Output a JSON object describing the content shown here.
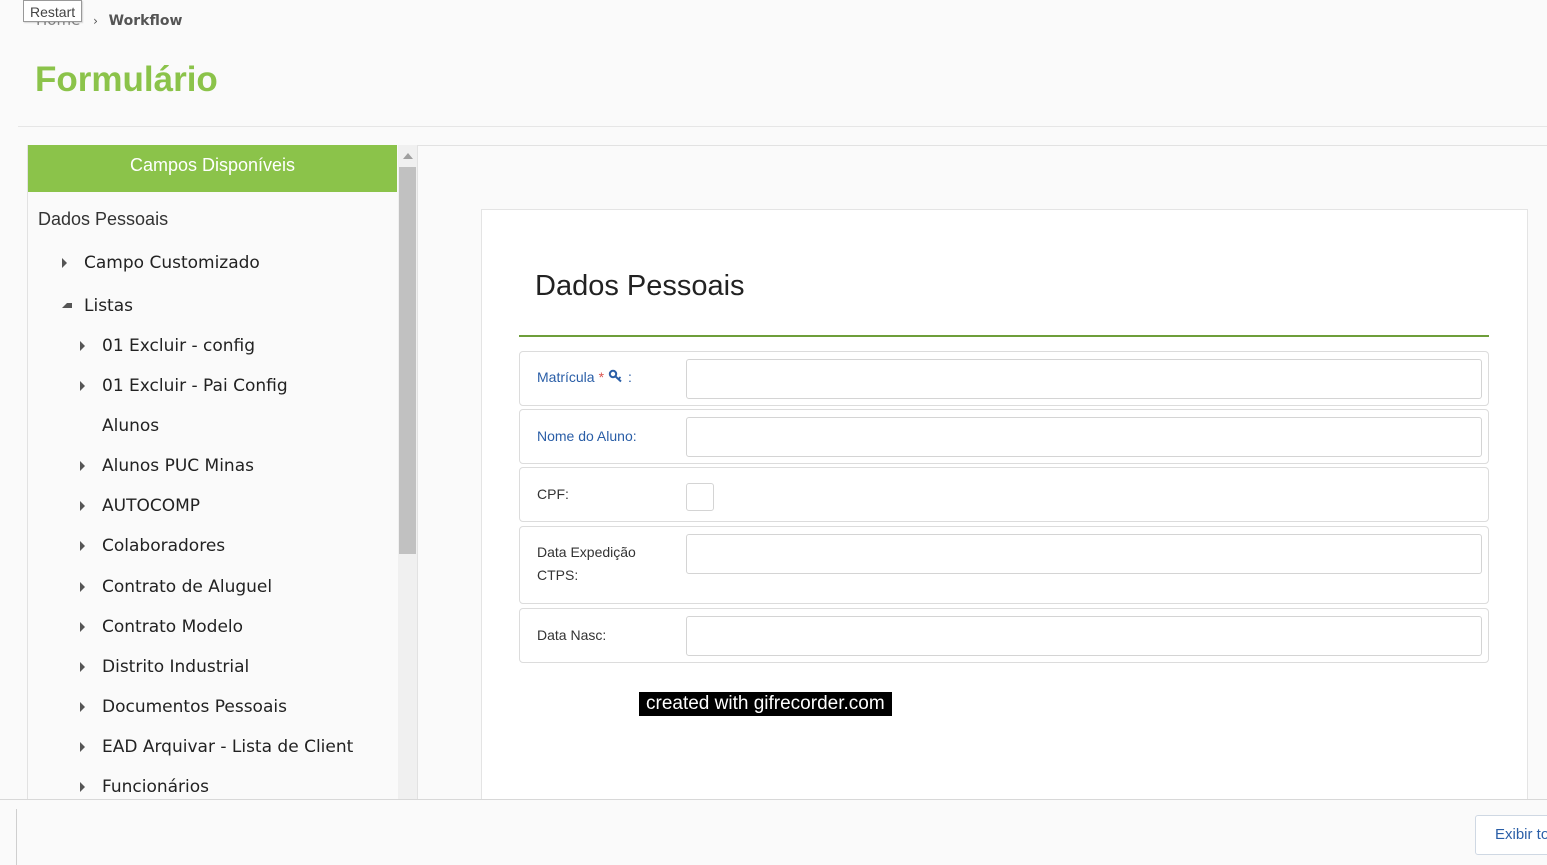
{
  "header": {
    "restart_label": "Restart",
    "breadcrumb_home": "Home",
    "breadcrumb_separator": "›",
    "breadcrumb_current": "Workflow",
    "page_title": "Formulário"
  },
  "sidebar": {
    "header": "Campos Disponíveis",
    "root": "Dados Pessoais",
    "items": [
      {
        "label": "Campo Customizado",
        "caret": "collapsed",
        "level": 1
      },
      {
        "label": "Listas",
        "caret": "expanded",
        "level": 1
      },
      {
        "label": "01 Excluir - config",
        "caret": "collapsed",
        "level": 2
      },
      {
        "label": "01 Excluir - Pai Config",
        "caret": "collapsed",
        "level": 2
      },
      {
        "label": "Alunos",
        "caret": "none",
        "level": 2
      },
      {
        "label": "Alunos PUC Minas",
        "caret": "collapsed",
        "level": 2
      },
      {
        "label": "AUTOCOMP",
        "caret": "collapsed",
        "level": 2
      },
      {
        "label": "Colaboradores",
        "caret": "collapsed",
        "level": 2
      },
      {
        "label": "Contrato de Aluguel",
        "caret": "collapsed",
        "level": 2
      },
      {
        "label": "Contrato Modelo",
        "caret": "collapsed",
        "level": 2
      },
      {
        "label": "Distrito Industrial",
        "caret": "collapsed",
        "level": 2
      },
      {
        "label": "Documentos Pessoais",
        "caret": "collapsed",
        "level": 2
      },
      {
        "label": "EAD Arquivar - Lista de Client",
        "caret": "collapsed",
        "level": 2
      },
      {
        "label": "Funcionários",
        "caret": "collapsed",
        "level": 2
      }
    ]
  },
  "form": {
    "title": "Dados Pessoais",
    "fields": [
      {
        "label": "Matrícula",
        "required": "*",
        "suffix": ":",
        "type": "text",
        "value": "",
        "style": "blue"
      },
      {
        "label": "Nome do Aluno:",
        "type": "text",
        "value": "",
        "style": "blue"
      },
      {
        "label": "CPF:",
        "type": "checkbox",
        "style": "dark"
      },
      {
        "label": "Data Expedição CTPS:",
        "type": "text",
        "value": "",
        "style": "dark"
      },
      {
        "label": "Data Nasc:",
        "type": "text",
        "value": "",
        "style": "dark"
      }
    ]
  },
  "watermark": "created with gifrecorder.com",
  "footer": {
    "exibir_label": "Exibir to"
  },
  "colors": {
    "accent_green": "#8bc34a",
    "divider_green": "#6e9e3a",
    "link_blue": "#2a5ea7",
    "required_red": "#d9534f"
  },
  "icons": {
    "key": "key-icon",
    "caret_right": "caret-right-icon",
    "caret_down": "caret-down-icon",
    "scroll_up": "scroll-up-arrow-icon"
  }
}
